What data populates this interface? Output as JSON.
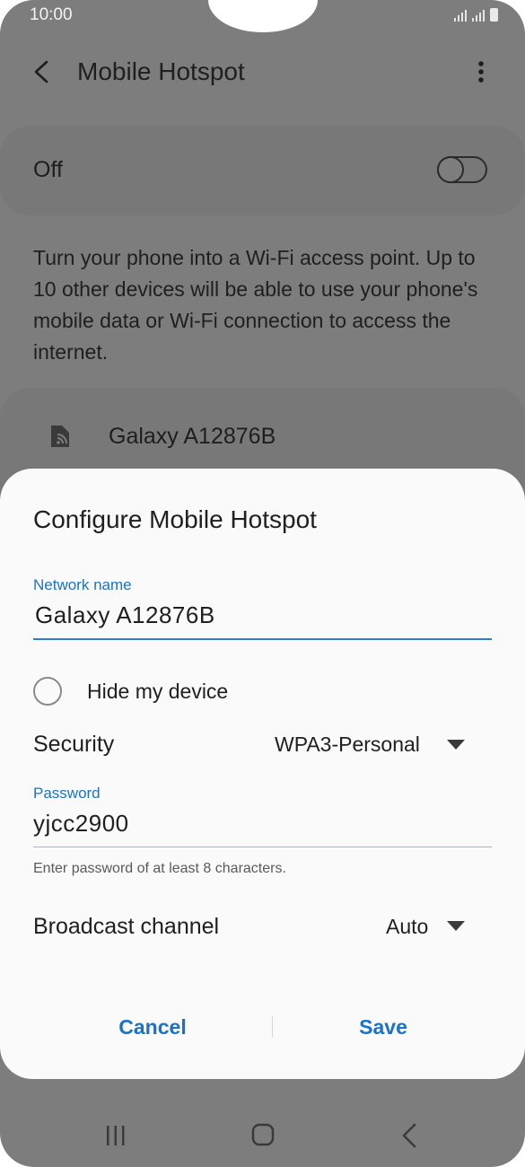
{
  "status_bar": {
    "time": "10:00"
  },
  "app_bar": {
    "title": "Mobile Hotspot"
  },
  "hotspot_toggle": {
    "label": "Off",
    "enabled": false
  },
  "description": "Turn your phone into a Wi-Fi access point. Up to 10 other devices will be able to use your phone's mobile data or Wi-Fi connection to access the internet.",
  "device": {
    "name": "Galaxy A12876B"
  },
  "dialog": {
    "title": "Configure Mobile Hotspot",
    "network_name": {
      "label": "Network name",
      "value": "Galaxy A12876B"
    },
    "hide_device": {
      "label": "Hide my device",
      "checked": false
    },
    "security": {
      "label": "Security",
      "value": "WPA3-Personal"
    },
    "password": {
      "label": "Password",
      "value": "yjcc2900",
      "helper": "Enter password of at least 8 characters."
    },
    "broadcast_channel": {
      "label": "Broadcast channel",
      "value": "Auto"
    },
    "cancel_label": "Cancel",
    "save_label": "Save"
  },
  "colors": {
    "accent": "#1a73c6",
    "scrim_background": "#7d7d7d",
    "dialog_background": "#fafafa"
  },
  "icons": {
    "back": "back-arrow-icon",
    "more": "more-vert-icon",
    "device": "hotspot-device-icon",
    "nav_recents": "recents-icon",
    "nav_home": "home-icon",
    "nav_back": "nav-back-icon"
  }
}
